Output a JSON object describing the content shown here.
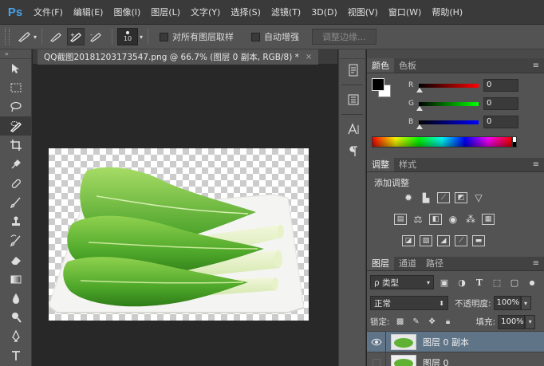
{
  "app": {
    "logo": "Ps",
    "menu": [
      "文件(F)",
      "编辑(E)",
      "图像(I)",
      "图层(L)",
      "文字(Y)",
      "选择(S)",
      "滤镜(T)",
      "3D(D)",
      "视图(V)",
      "窗口(W)",
      "帮助(H)"
    ]
  },
  "options": {
    "brush_size": "10",
    "sample_all_layers": "对所有图层取样",
    "auto_enhance": "自动增强",
    "refine_edge": "调整边缘..."
  },
  "document": {
    "tab_title": "QQ截图20181203173547.png @ 66.7% (图层 0 副本, RGB/8) *",
    "close": "×"
  },
  "colors": {
    "tabs": [
      "颜色",
      "色板"
    ],
    "channels": [
      {
        "label": "R",
        "value": "0"
      },
      {
        "label": "G",
        "value": "0"
      },
      {
        "label": "B",
        "value": "0"
      }
    ],
    "foreground": "#000000",
    "background": "#ffffff"
  },
  "adjustments": {
    "tabs": [
      "调整",
      "样式"
    ],
    "title": "添加调整"
  },
  "layers": {
    "tabs": [
      "图层",
      "通道",
      "路径"
    ],
    "type_filter": "ρ 类型",
    "blend_mode": "正常",
    "opacity_label": "不透明度:",
    "opacity": "100%",
    "lock_label": "锁定:",
    "fill_label": "填充:",
    "fill": "100%",
    "items": [
      {
        "name": "图层 0 副本",
        "selected": true,
        "visible": true
      },
      {
        "name": "图层 0",
        "selected": false,
        "visible": false
      }
    ]
  }
}
